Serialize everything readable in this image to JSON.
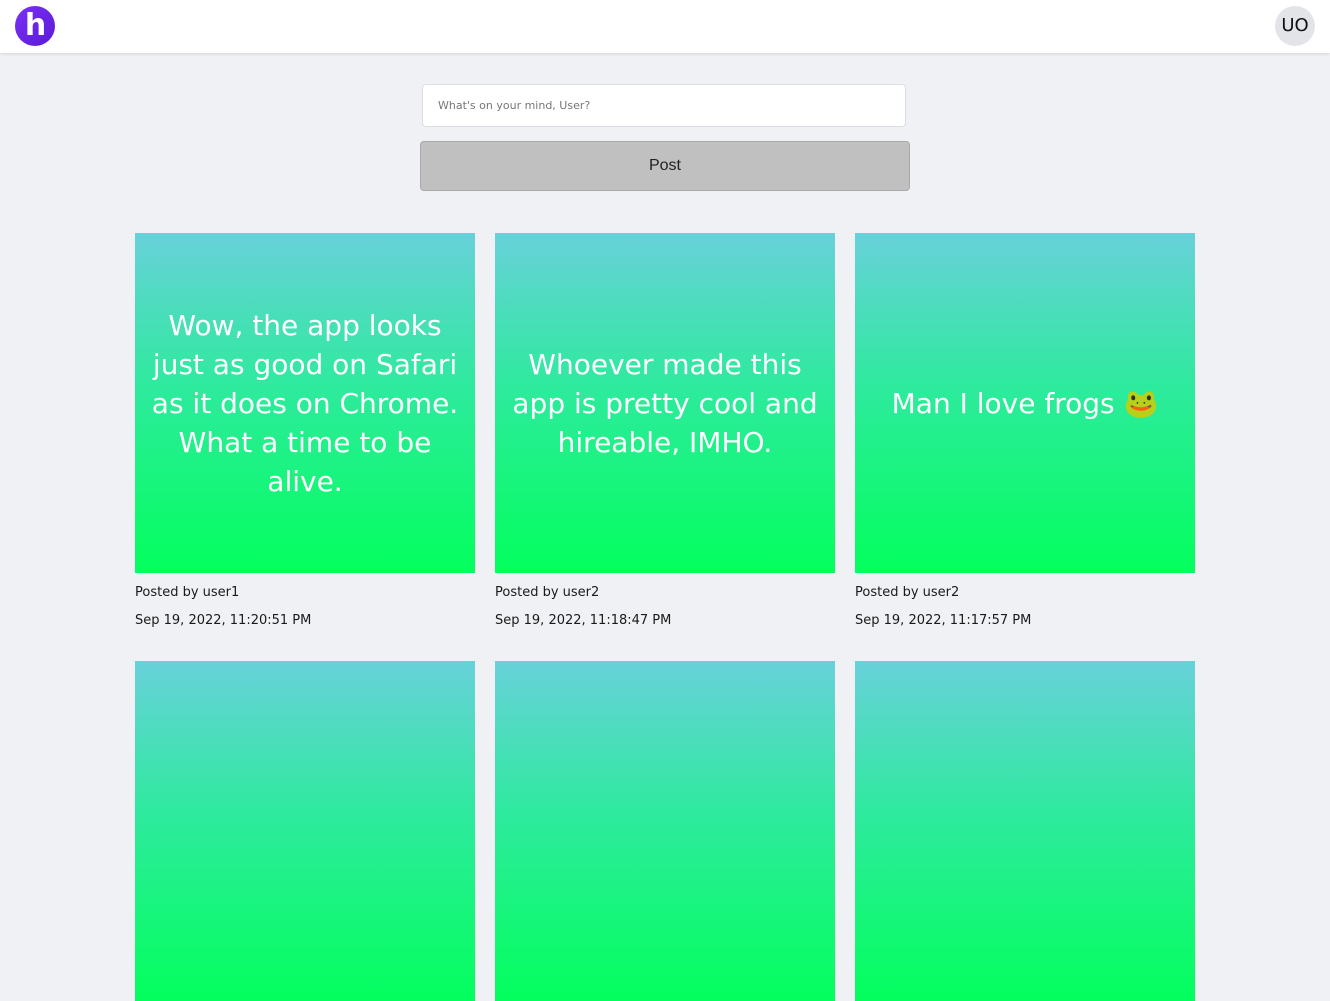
{
  "header": {
    "logo_letter": "h",
    "user_initials": "UO"
  },
  "composer": {
    "placeholder": "What's on your mind, User?",
    "value": "",
    "post_label": "Post"
  },
  "posts": [
    {
      "text": "Wow, the app looks just as good on Safari as it does on Chrome. What a time to be alive.",
      "author_line": "Posted by user1",
      "timestamp": "Sep 19, 2022, 11:20:51 PM"
    },
    {
      "text": "Whoever made this app is pretty cool and hireable, IMHO.",
      "author_line": "Posted by user2",
      "timestamp": "Sep 19, 2022, 11:18:47 PM"
    },
    {
      "text": "Man I love frogs 🐸",
      "author_line": "Posted by user2",
      "timestamp": "Sep 19, 2022, 11:17:57 PM"
    },
    {
      "text": ""
    },
    {
      "text": ""
    },
    {
      "text": ""
    }
  ],
  "colors": {
    "gradient_top": "#68d1da",
    "gradient_bottom": "#03ff5d",
    "logo": "#6a24e8",
    "page_bg": "#f0f1f5",
    "post_button": "#c0c0c0"
  }
}
